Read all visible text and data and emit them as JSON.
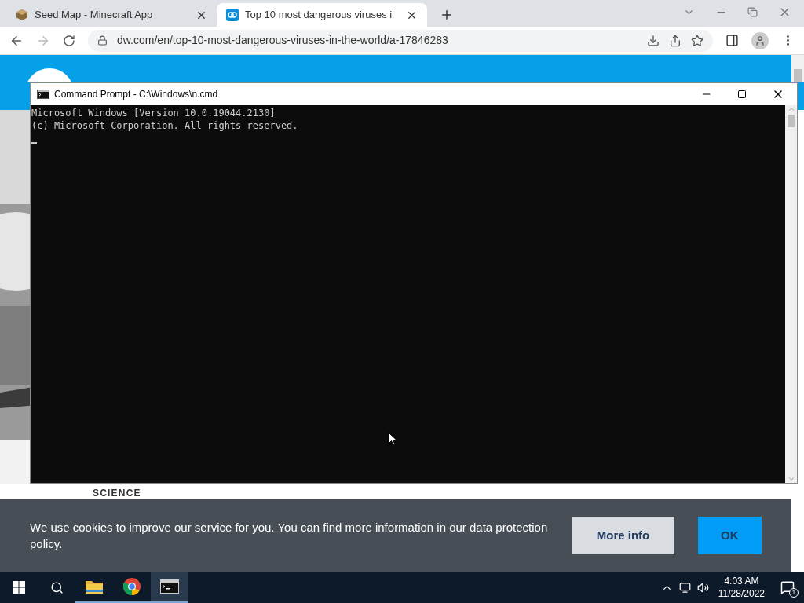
{
  "browser": {
    "tabs": [
      {
        "title": "Seed Map - Minecraft App",
        "selected": false
      },
      {
        "title": "Top 10 most dangerous viruses i",
        "selected": true
      }
    ],
    "address": "dw.com/en/top-10-most-dangerous-viruses-in-the-world/a-17846283"
  },
  "page": {
    "section": "SCIENCE"
  },
  "cmd": {
    "title": "Command Prompt - C:\\Windows\\n.cmd",
    "lines": [
      "Microsoft Windows [Version 10.0.19044.2130]",
      "(c) Microsoft Corporation. All rights reserved."
    ]
  },
  "cookie": {
    "text": "We use cookies to improve our service for you. You can find more information in our data protection policy.",
    "buttons": [
      {
        "label": "More info",
        "kind": "secondary"
      },
      {
        "label": "OK",
        "kind": "primary"
      }
    ]
  },
  "taskbar": {
    "apps": [
      {
        "kind": "explorer",
        "active": false
      },
      {
        "kind": "chrome",
        "active": false
      },
      {
        "kind": "terminal",
        "active": true
      }
    ],
    "time": "4:03 AM",
    "date": "11/28/2022",
    "notifications": "1"
  }
}
